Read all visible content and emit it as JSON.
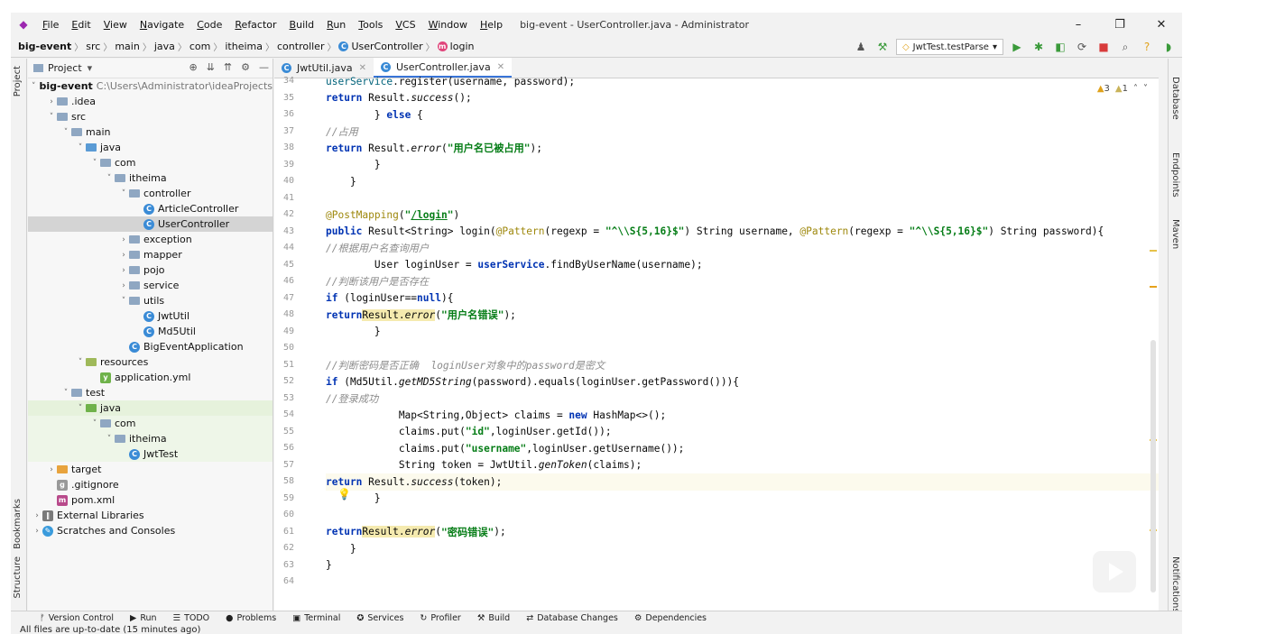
{
  "window": {
    "title": "big-event - UserController.java - Administrator",
    "menu": [
      "File",
      "Edit",
      "View",
      "Navigate",
      "Code",
      "Refactor",
      "Build",
      "Run",
      "Tools",
      "VCS",
      "Window",
      "Help"
    ],
    "controls": {
      "minimize": "–",
      "maximize": "❐",
      "close": "✕"
    }
  },
  "breadcrumb": [
    "big-event",
    "src",
    "main",
    "java",
    "com",
    "itheima",
    "controller",
    "UserController",
    "login"
  ],
  "run_config": "JwtTest.testParse",
  "project_panel": {
    "title": "Project",
    "tree": [
      {
        "label": "big-event",
        "path": "C:\\Users\\Administrator\\ideaProjects",
        "depth": 0,
        "arrow": "˅",
        "icon": "folder",
        "bold": true
      },
      {
        "label": ".idea",
        "depth": 1,
        "arrow": "›",
        "icon": "folder"
      },
      {
        "label": "src",
        "depth": 1,
        "arrow": "˅",
        "icon": "folder"
      },
      {
        "label": "main",
        "depth": 2,
        "arrow": "˅",
        "icon": "folder"
      },
      {
        "label": "java",
        "depth": 3,
        "arrow": "˅",
        "icon": "folder-src"
      },
      {
        "label": "com",
        "depth": 4,
        "arrow": "˅",
        "icon": "folder"
      },
      {
        "label": "itheima",
        "depth": 5,
        "arrow": "˅",
        "icon": "folder"
      },
      {
        "label": "controller",
        "depth": 6,
        "arrow": "˅",
        "icon": "folder"
      },
      {
        "label": "ArticleController",
        "depth": 7,
        "arrow": "",
        "icon": "class"
      },
      {
        "label": "UserController",
        "depth": 7,
        "arrow": "",
        "icon": "class",
        "selected": true
      },
      {
        "label": "exception",
        "depth": 6,
        "arrow": "›",
        "icon": "folder"
      },
      {
        "label": "mapper",
        "depth": 6,
        "arrow": "›",
        "icon": "folder"
      },
      {
        "label": "pojo",
        "depth": 6,
        "arrow": "›",
        "icon": "folder"
      },
      {
        "label": "service",
        "depth": 6,
        "arrow": "›",
        "icon": "folder"
      },
      {
        "label": "utils",
        "depth": 6,
        "arrow": "˅",
        "icon": "folder"
      },
      {
        "label": "JwtUtil",
        "depth": 7,
        "arrow": "",
        "icon": "class"
      },
      {
        "label": "Md5Util",
        "depth": 7,
        "arrow": "",
        "icon": "class"
      },
      {
        "label": "BigEventApplication",
        "depth": 6,
        "arrow": "",
        "icon": "class"
      },
      {
        "label": "resources",
        "depth": 3,
        "arrow": "˅",
        "icon": "folder-res"
      },
      {
        "label": "application.yml",
        "depth": 4,
        "arrow": "",
        "icon": "yml"
      },
      {
        "label": "test",
        "depth": 2,
        "arrow": "˅",
        "icon": "folder"
      },
      {
        "label": "java",
        "depth": 3,
        "arrow": "˅",
        "icon": "folder-test",
        "test": true
      },
      {
        "label": "com",
        "depth": 4,
        "arrow": "˅",
        "icon": "folder",
        "test": true
      },
      {
        "label": "itheima",
        "depth": 5,
        "arrow": "˅",
        "icon": "folder",
        "test": true
      },
      {
        "label": "JwtTest",
        "depth": 6,
        "arrow": "",
        "icon": "class",
        "test": true
      },
      {
        "label": "target",
        "depth": 1,
        "arrow": "›",
        "icon": "folder-target"
      },
      {
        "label": ".gitignore",
        "depth": 1,
        "arrow": "",
        "icon": "git"
      },
      {
        "label": "pom.xml",
        "depth": 1,
        "arrow": "",
        "icon": "maven"
      },
      {
        "label": "External Libraries",
        "depth": 0,
        "arrow": "›",
        "icon": "lib"
      },
      {
        "label": "Scratches and Consoles",
        "depth": 0,
        "arrow": "›",
        "icon": "scratch"
      }
    ]
  },
  "editor": {
    "tabs": [
      {
        "label": "JwtUtil.java",
        "active": false
      },
      {
        "label": "UserController.java",
        "active": true
      }
    ],
    "inspections": {
      "warnings": "3",
      "weak": "1"
    },
    "current_line": 58,
    "lines": [
      {
        "n": "34",
        "html": "            <span class=\"fn\">userService</span>.register(username, password);"
      },
      {
        "n": "35",
        "html": "            <span class=\"kw\">return</span> Result.<span class=\"it\">success</span>();"
      },
      {
        "n": "36",
        "html": "        } <span class=\"kw\">else</span> {"
      },
      {
        "n": "37",
        "html": "            <span class=\"cm\">//占用</span>"
      },
      {
        "n": "38",
        "html": "            <span class=\"kw\">return</span> Result.<span class=\"it\">error</span>(<span class=\"str\">\"用户名已被占用\"</span>);"
      },
      {
        "n": "39",
        "html": "        }"
      },
      {
        "n": "40",
        "html": "    }"
      },
      {
        "n": "41",
        "html": ""
      },
      {
        "n": "42",
        "html": "    <span class=\"ann\">@PostMapping</span>(<span class=\"str\">\"<u>/login</u>\"</span>)"
      },
      {
        "n": "43",
        "html": "    <span class=\"kw\">public</span> Result&lt;String&gt; login(<span class=\"ann\">@Pattern</span>(regexp = <span class=\"str\">\"^\\\\S{5,16}$\"</span>) String username, <span class=\"ann\">@Pattern</span>(regexp = <span class=\"str\">\"^\\\\S{5,16}$\"</span>) String password){"
      },
      {
        "n": "44",
        "html": "        <span class=\"cm\">//根据用户名查询用户</span>"
      },
      {
        "n": "45",
        "html": "        User loginUser = <span class=\"kw\">userService</span>.findByUserName(username);"
      },
      {
        "n": "46",
        "html": "        <span class=\"cm\">//判断该用户是否存在</span>"
      },
      {
        "n": "47",
        "html": "        <span class=\"kw\">if</span> (loginUser==<span class=\"kw\">null</span>){"
      },
      {
        "n": "48",
        "html": "            <span class=\"kw\">return</span> <span class=\"hl\">Result.<span class=\"it\">error</span></span>(<span class=\"str\">\"用户名错误\"</span>);"
      },
      {
        "n": "49",
        "html": "        }"
      },
      {
        "n": "50",
        "html": ""
      },
      {
        "n": "51",
        "html": "        <span class=\"cm\">//判断密码是否正确  loginUser对象中的password是密文</span>"
      },
      {
        "n": "52",
        "html": "        <span class=\"kw\">if</span> (Md5Util.<span class=\"it\">getMD5String</span>(password).equals(loginUser.getPassword())){"
      },
      {
        "n": "53",
        "html": "            <span class=\"cm\">//登录成功</span>"
      },
      {
        "n": "54",
        "html": "            Map&lt;String,Object&gt; claims = <span class=\"kw\">new</span> HashMap&lt;&gt;();"
      },
      {
        "n": "55",
        "html": "            claims.put(<span class=\"str\">\"id\"</span>,loginUser.getId());"
      },
      {
        "n": "56",
        "html": "            claims.put(<span class=\"str\">\"username\"</span>,loginUser.getUsername());"
      },
      {
        "n": "57",
        "html": "            String token = JwtUtil.<span class=\"it\">genToken</span>(claims);"
      },
      {
        "n": "58",
        "html": "            <span class=\"kw\">return</span> Result.<span class=\"it\">success</span>(token);"
      },
      {
        "n": "59",
        "html": "        }"
      },
      {
        "n": "60",
        "html": ""
      },
      {
        "n": "61",
        "html": "        <span class=\"kw\">return</span> <span class=\"hl\">Result.<span class=\"it\">error</span></span>(<span class=\"str\">\"密码错误\"</span>);"
      },
      {
        "n": "62",
        "html": "    }"
      },
      {
        "n": "63",
        "html": "}"
      },
      {
        "n": "64",
        "html": ""
      }
    ]
  },
  "left_strip": [
    "Project",
    "Bookmarks",
    "Structure"
  ],
  "right_strip": [
    "Database",
    "Endpoints",
    "Maven",
    "Notifications"
  ],
  "bottom_tools": [
    "Version Control",
    "Run",
    "TODO",
    "Problems",
    "Terminal",
    "Services",
    "Profiler",
    "Build",
    "Database Changes",
    "Dependencies"
  ],
  "status": "All files are up-to-date (15 minutes ago)"
}
